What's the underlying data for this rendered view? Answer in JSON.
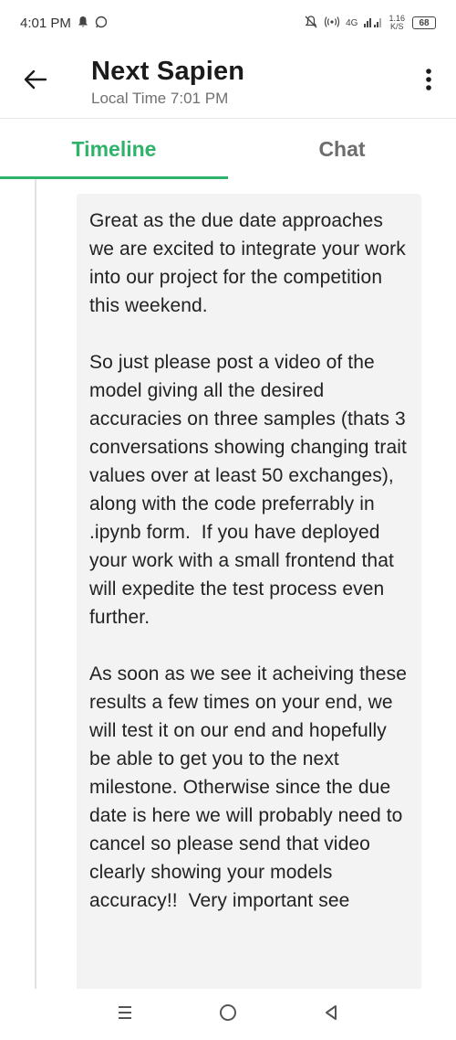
{
  "status_bar": {
    "time": "4:01 PM",
    "net_speed_value": "1.16",
    "net_speed_unit": "K/S",
    "network_type": "4G",
    "battery": "68",
    "icons": [
      "notification-icon",
      "whatsapp-icon",
      "mute-icon",
      "hotspot-icon",
      "signal-icon",
      "battery-icon"
    ]
  },
  "header": {
    "title": "Next Sapien",
    "subtitle": "Local Time 7:01 PM",
    "back_icon": "arrow-left-icon",
    "menu_icon": "more-vertical-icon"
  },
  "tabs": [
    {
      "label": "Timeline",
      "active": true
    },
    {
      "label": "Chat",
      "active": false
    }
  ],
  "accent_color": "#2fb36b",
  "message": {
    "text": "Great as the due date approaches we are excited to integrate your work into our project for the competition this weekend.\n\nSo just please post a video of the model giving all the desired accuracies on three samples (thats 3 conversations showing changing trait values over at least 50 exchanges), along with the code preferrably in .ipynb form.  If you have deployed your work with a small frontend that will expedite the test process even further.\n\nAs soon as we see it acheiving these results a few times on your end, we will test it on our end and hopefully be able to get you to the next milestone. Otherwise since the due date is here we will probably need to cancel so please send that video clearly showing your models accuracy!!  Very important see"
  },
  "nav_bar": {
    "icons": [
      "recents-icon",
      "home-icon",
      "back-icon"
    ]
  }
}
